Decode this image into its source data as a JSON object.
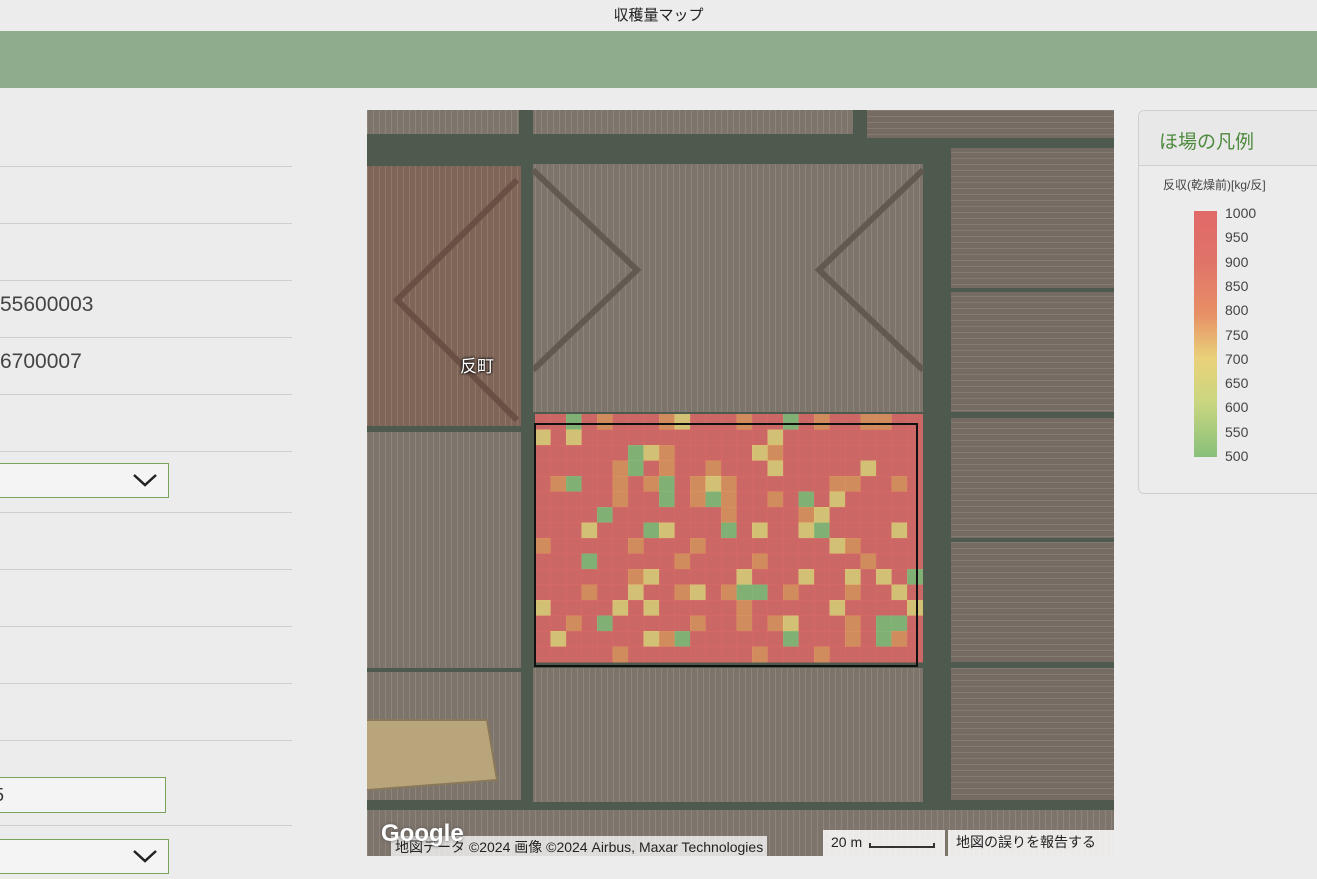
{
  "header": {
    "title": "収穫量マップ"
  },
  "form": {
    "values": [
      "55600003",
      "6700007"
    ],
    "input_partial": "5"
  },
  "map": {
    "place_label": "反町",
    "logo_text": "Google",
    "attribution": "地図データ ©2024 画像 ©2024 Airbus, Maxar Technologies",
    "scale_text": "20 m",
    "report_text": "地図の誤りを報告する"
  },
  "legend": {
    "title": "ほ場の凡例",
    "unit": "反収(乾燥前)[kg/反]",
    "ticks": [
      "1000",
      "950",
      "900",
      "850",
      "800",
      "750",
      "700",
      "650",
      "600",
      "550",
      "500"
    ],
    "colors": {
      "high": "#e06a68",
      "mid": "#e9d27a",
      "low": "#88c07a"
    }
  },
  "colors": {
    "band": "#8fac8c",
    "accent_border": "#7ca35a",
    "legend_title": "#4d8a3d"
  }
}
